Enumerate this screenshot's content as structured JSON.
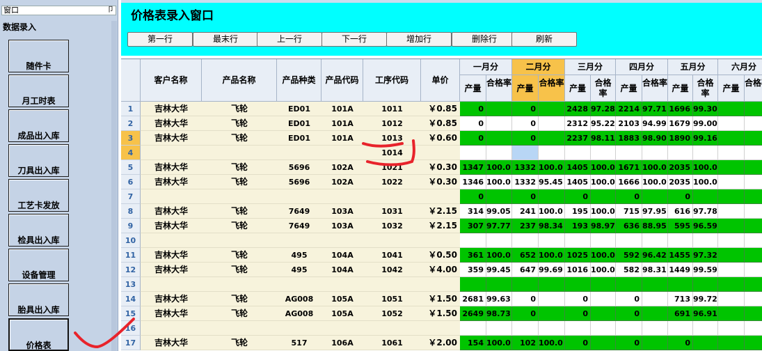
{
  "sidebar": {
    "panel_title": "窗口",
    "pin_icon": "pin-icon",
    "section_title": "数据录入",
    "buttons": [
      "随件卡",
      "月工时表",
      "成品出入库",
      "刀具出入库",
      "工艺卡发放",
      "检具出入库",
      "设备管理",
      "胎具出入库",
      "价格表"
    ]
  },
  "window": {
    "title": "价格表录入窗口",
    "toolbar": [
      "第一行",
      "最末行",
      "上一行",
      "下一行",
      "增加行",
      "删除行",
      "刷新"
    ]
  },
  "grid": {
    "columns": [
      "客户名称",
      "产品名称",
      "产品种类",
      "产品代码",
      "工序代码",
      "单价"
    ],
    "months": [
      "一月分",
      "二月分",
      "三月分",
      "四月分",
      "五月分",
      "六月分"
    ],
    "sub_cols": [
      "产量",
      "合格率"
    ],
    "rows": [
      {
        "n": "1",
        "cust": "吉林大华",
        "prod": "飞轮",
        "kind": "ED01",
        "code": "101A",
        "proc": "1011",
        "price": "￥0.85",
        "m": [
          [
            "0",
            ""
          ],
          [
            "0",
            ""
          ],
          [
            "2428",
            "97.28"
          ],
          [
            "2214",
            "97.71"
          ],
          [
            "1696",
            "99.30"
          ],
          [
            "",
            ""
          ]
        ],
        "color": "green"
      },
      {
        "n": "2",
        "cust": "吉林大华",
        "prod": "飞轮",
        "kind": "ED01",
        "code": "101A",
        "proc": "1012",
        "price": "￥0.85",
        "m": [
          [
            "0",
            ""
          ],
          [
            "0",
            ""
          ],
          [
            "2312",
            "95.22"
          ],
          [
            "2103",
            "94.99"
          ],
          [
            "1679",
            "99.00"
          ],
          [
            "",
            ""
          ]
        ],
        "color": "white"
      },
      {
        "n": "3",
        "cust": "吉林大华",
        "prod": "飞轮",
        "kind": "ED01",
        "code": "101A",
        "proc": "1013",
        "price": "￥0.60",
        "m": [
          [
            "0",
            ""
          ],
          [
            "0",
            ""
          ],
          [
            "2237",
            "98.11"
          ],
          [
            "1883",
            "98.90"
          ],
          [
            "1890",
            "99.16"
          ],
          [
            "",
            ""
          ]
        ],
        "color": "green",
        "sel": true
      },
      {
        "n": "4",
        "cust": "",
        "prod": "",
        "kind": "",
        "code": "",
        "proc": "1014",
        "price": "",
        "m": [
          [
            "",
            ""
          ],
          [
            "",
            ""
          ],
          [
            "",
            ""
          ],
          [
            "",
            ""
          ],
          [
            "",
            ""
          ],
          [
            "",
            ""
          ]
        ],
        "color": "white",
        "sel": true
      },
      {
        "n": "5",
        "cust": "吉林大华",
        "prod": "飞轮",
        "kind": "5696",
        "code": "102A",
        "proc": "1021",
        "price": "￥0.30",
        "m": [
          [
            "1347",
            "100.0"
          ],
          [
            "1332",
            "100.0"
          ],
          [
            "1405",
            "100.0"
          ],
          [
            "1671",
            "100.0"
          ],
          [
            "2035",
            "100.0"
          ],
          [
            "",
            ""
          ]
        ],
        "color": "green"
      },
      {
        "n": "6",
        "cust": "吉林大华",
        "prod": "飞轮",
        "kind": "5696",
        "code": "102A",
        "proc": "1022",
        "price": "￥0.30",
        "m": [
          [
            "1346",
            "100.0"
          ],
          [
            "1332",
            "95.45"
          ],
          [
            "1405",
            "100.0"
          ],
          [
            "1666",
            "100.0"
          ],
          [
            "2035",
            "100.0"
          ],
          [
            "",
            ""
          ]
        ],
        "color": "white"
      },
      {
        "n": "7",
        "cust": "",
        "prod": "",
        "kind": "",
        "code": "",
        "proc": "",
        "price": "",
        "m": [
          [
            "0",
            ""
          ],
          [
            "0",
            ""
          ],
          [
            "0",
            ""
          ],
          [
            "0",
            ""
          ],
          [
            "0",
            ""
          ],
          [
            "",
            ""
          ]
        ],
        "color": "green"
      },
      {
        "n": "8",
        "cust": "吉林大华",
        "prod": "飞轮",
        "kind": "7649",
        "code": "103A",
        "proc": "1031",
        "price": "￥2.15",
        "m": [
          [
            "314",
            "99.05"
          ],
          [
            "241",
            "100.0"
          ],
          [
            "195",
            "100.0"
          ],
          [
            "715",
            "97.95"
          ],
          [
            "616",
            "97.78"
          ],
          [
            "",
            ""
          ]
        ],
        "color": "white"
      },
      {
        "n": "9",
        "cust": "吉林大华",
        "prod": "飞轮",
        "kind": "7649",
        "code": "103A",
        "proc": "1032",
        "price": "￥2.15",
        "m": [
          [
            "307",
            "97.77"
          ],
          [
            "237",
            "98.34"
          ],
          [
            "193",
            "98.97"
          ],
          [
            "636",
            "88.95"
          ],
          [
            "595",
            "96.59"
          ],
          [
            "",
            ""
          ]
        ],
        "color": "green"
      },
      {
        "n": "10",
        "cust": "",
        "prod": "",
        "kind": "",
        "code": "",
        "proc": "",
        "price": "",
        "m": [
          [
            "",
            ""
          ],
          [
            "",
            ""
          ],
          [
            "",
            ""
          ],
          [
            "",
            ""
          ],
          [
            "",
            ""
          ],
          [
            "",
            ""
          ]
        ],
        "color": "white"
      },
      {
        "n": "11",
        "cust": "吉林大华",
        "prod": "飞轮",
        "kind": "495",
        "code": "104A",
        "proc": "1041",
        "price": "￥0.50",
        "m": [
          [
            "361",
            "100.0"
          ],
          [
            "652",
            "100.0"
          ],
          [
            "1025",
            "100.0"
          ],
          [
            "592",
            "96.42"
          ],
          [
            "1455",
            "97.32"
          ],
          [
            "",
            ""
          ]
        ],
        "color": "green"
      },
      {
        "n": "12",
        "cust": "吉林大华",
        "prod": "飞轮",
        "kind": "495",
        "code": "104A",
        "proc": "1042",
        "price": "￥4.00",
        "m": [
          [
            "359",
            "99.45"
          ],
          [
            "647",
            "99.69"
          ],
          [
            "1016",
            "100.0"
          ],
          [
            "582",
            "98.31"
          ],
          [
            "1449",
            "99.59"
          ],
          [
            "",
            ""
          ]
        ],
        "color": "white"
      },
      {
        "n": "13",
        "cust": "",
        "prod": "",
        "kind": "",
        "code": "",
        "proc": "",
        "price": "",
        "m": [
          [
            "",
            ""
          ],
          [
            "",
            ""
          ],
          [
            "",
            ""
          ],
          [
            "",
            ""
          ],
          [
            "",
            ""
          ],
          [
            "",
            ""
          ]
        ],
        "color": "green"
      },
      {
        "n": "14",
        "cust": "吉林大华",
        "prod": "飞轮",
        "kind": "AG008",
        "code": "105A",
        "proc": "1051",
        "price": "￥1.50",
        "m": [
          [
            "2681",
            "99.63"
          ],
          [
            "0",
            ""
          ],
          [
            "0",
            ""
          ],
          [
            "0",
            ""
          ],
          [
            "713",
            "99.72"
          ],
          [
            "",
            ""
          ]
        ],
        "color": "white"
      },
      {
        "n": "15",
        "cust": "吉林大华",
        "prod": "飞轮",
        "kind": "AG008",
        "code": "105A",
        "proc": "1052",
        "price": "￥1.50",
        "m": [
          [
            "2649",
            "98.73"
          ],
          [
            "0",
            ""
          ],
          [
            "0",
            ""
          ],
          [
            "0",
            ""
          ],
          [
            "691",
            "96.91"
          ],
          [
            "",
            ""
          ]
        ],
        "color": "green"
      },
      {
        "n": "16",
        "cust": "",
        "prod": "",
        "kind": "",
        "code": "",
        "proc": "",
        "price": "",
        "m": [
          [
            "",
            ""
          ],
          [
            "",
            ""
          ],
          [
            "",
            ""
          ],
          [
            "",
            ""
          ],
          [
            "",
            ""
          ],
          [
            "",
            ""
          ]
        ],
        "color": "white"
      },
      {
        "n": "17",
        "cust": "吉林大华",
        "prod": "飞轮",
        "kind": "517",
        "code": "106A",
        "proc": "1061",
        "price": "￥2.00",
        "m": [
          [
            "154",
            "100.0"
          ],
          [
            "102",
            "100.0"
          ],
          [
            "0",
            ""
          ],
          [
            "0",
            ""
          ],
          [
            "0",
            ""
          ],
          [
            "",
            ""
          ]
        ],
        "color": "green"
      }
    ]
  },
  "colors": {
    "header_bg": "#00ffff",
    "green": "#00c400",
    "selected_header": "#f7c24a",
    "annotation": "#e8232b"
  }
}
